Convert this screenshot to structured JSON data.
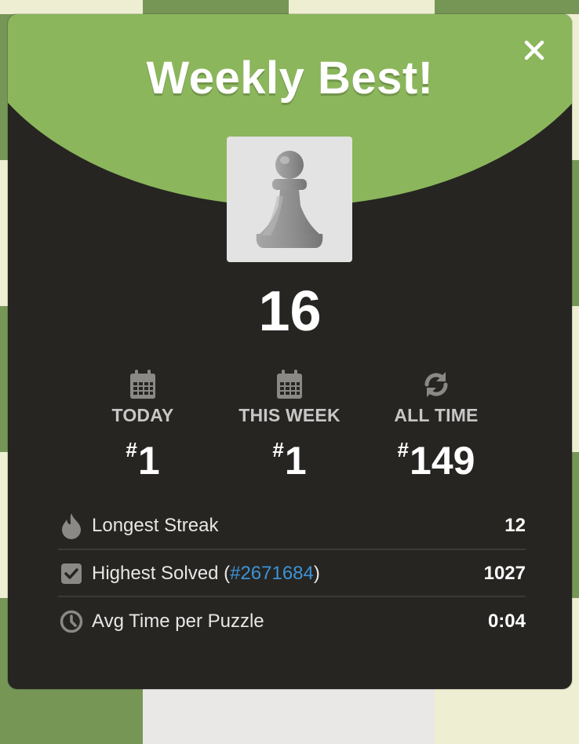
{
  "modal": {
    "title": "Weekly Best!",
    "score": "16",
    "close_icon": "close-icon"
  },
  "rankings": [
    {
      "label": "TODAY",
      "hash": "#",
      "rank": "1",
      "icon": "calendar-icon"
    },
    {
      "label": "THIS WEEK",
      "hash": "#",
      "rank": "1",
      "icon": "calendar-icon"
    },
    {
      "label": "ALL TIME",
      "hash": "#",
      "rank": "149",
      "icon": "refresh-icon"
    }
  ],
  "stats": [
    {
      "label": "Longest Streak",
      "value": "12",
      "icon": "flame-icon"
    },
    {
      "label_prefix": "Highest Solved (",
      "link": "#2671684",
      "label_suffix": ")",
      "value": "1027",
      "icon": "checkbox-icon"
    },
    {
      "label": "Avg Time per Puzzle",
      "value": "0:04",
      "icon": "clock-icon"
    }
  ],
  "colors": {
    "header_green": "#8bb65c",
    "modal_bg": "#262522",
    "link_blue": "#3d92d6",
    "board_green": "#769656",
    "board_light": "#eeeed2"
  }
}
